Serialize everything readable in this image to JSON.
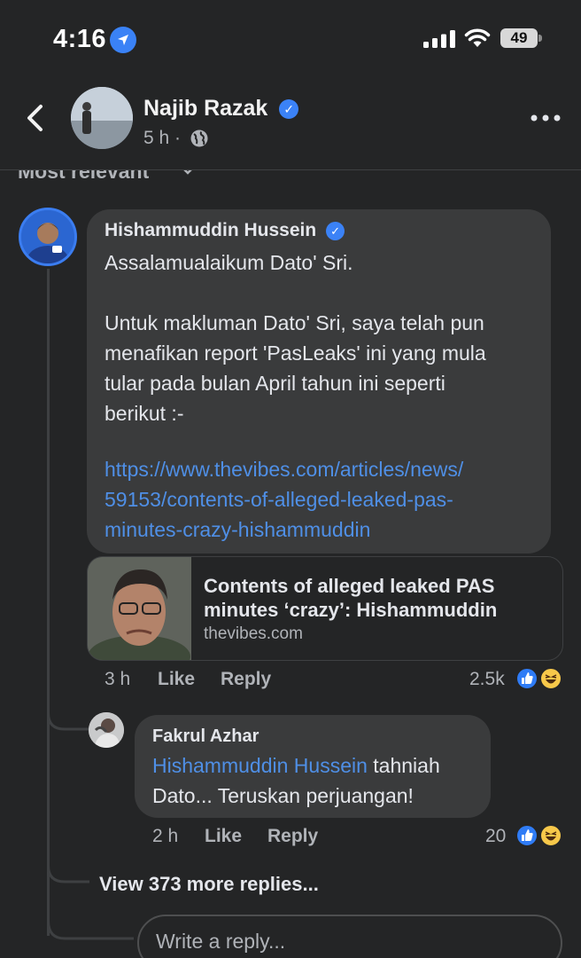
{
  "status_bar": {
    "time": "4:16",
    "battery": "49"
  },
  "header": {
    "name": "Najib Razak",
    "meta": "5 h ·"
  },
  "sort": {
    "label": "Most relevant"
  },
  "comment": {
    "author": "Hishammuddin Hussein",
    "text": "Assalamualaikum Dato' Sri.\n\nUntuk makluman Dato' Sri, saya telah pun\nmenafikan report 'PasLeaks' ini yang mula\ntular pada bulan April tahun ini seperti\nberikut :-",
    "link": "https://www.thevibes.com/articles/news/\n59153/contents-of-alleged-leaked-pas-\nminutes-crazy-hishammuddin",
    "preview": {
      "title": "Contents of alleged leaked PAS\nminutes ‘crazy’: Hishammuddin",
      "domain": "thevibes.com"
    },
    "time": "3 h",
    "like_label": "Like",
    "reply_label": "Reply",
    "reaction_count": "2.5k"
  },
  "reply": {
    "author": "Fakrul Azhar",
    "mention": "Hishammuddin Hussein",
    "text_after_mention": " tahniah",
    "text_line2": "Dato... Teruskan perjuangan!",
    "time": "2 h",
    "like_label": "Like",
    "reply_label": "Reply",
    "reaction_count": "20"
  },
  "more_replies": "View 373 more replies...",
  "reply_input": {
    "placeholder": "Write a reply..."
  }
}
